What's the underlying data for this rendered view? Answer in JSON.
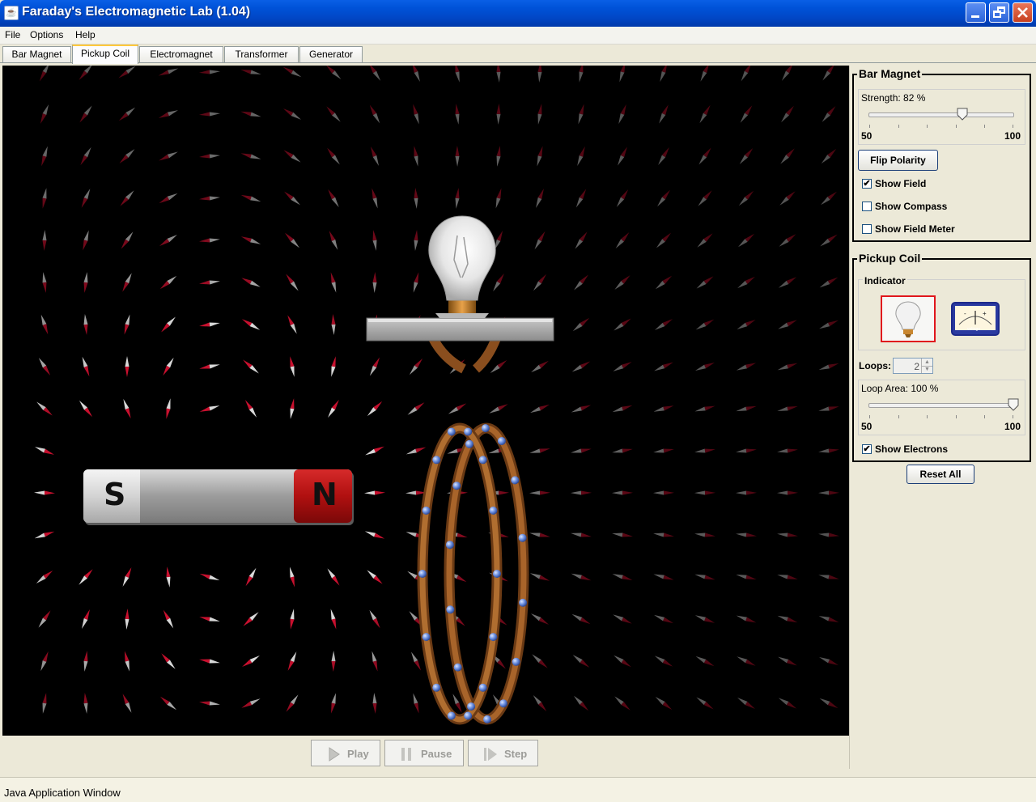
{
  "window": {
    "title": "Faraday's Electromagnetic Lab (1.04)"
  },
  "menu": {
    "file": "File",
    "options": "Options",
    "help": "Help"
  },
  "tabs": [
    {
      "label": "Bar Magnet"
    },
    {
      "label": "Pickup Coil",
      "active": true
    },
    {
      "label": "Electromagnet"
    },
    {
      "label": "Transformer"
    },
    {
      "label": "Generator"
    }
  ],
  "magnet": {
    "south_label": "S",
    "north_label": "N"
  },
  "bar_magnet_panel": {
    "title": "Bar Magnet",
    "strength_label": "Strength: 82 %",
    "strength_value": 82,
    "slider_min": "50",
    "slider_max": "100",
    "flip_polarity": "Flip Polarity",
    "show_field": {
      "label": "Show Field",
      "checked": true
    },
    "show_compass": {
      "label": "Show Compass",
      "checked": false
    },
    "show_field_meter": {
      "label": "Show Field Meter",
      "checked": false
    }
  },
  "pickup_coil_panel": {
    "title": "Pickup Coil",
    "indicator_label": "Indicator",
    "indicator_selected": "lightbulb",
    "voltmeter_text": "voltage",
    "loops_label": "Loops:",
    "loops_value": "2",
    "loop_area_label": "Loop Area: 100 %",
    "loop_area_value": 100,
    "slider_min": "50",
    "slider_max": "100",
    "show_electrons": {
      "label": "Show Electrons",
      "checked": true
    }
  },
  "reset_all": "Reset All",
  "controls": {
    "play": "Play",
    "pause": "Pause",
    "step": "Step"
  },
  "status": "Java Application Window",
  "colors": {
    "compass_north": "#c8102e",
    "coil": "#9a5a24",
    "electron": "#5a83d6",
    "selection": "#e0161c"
  }
}
